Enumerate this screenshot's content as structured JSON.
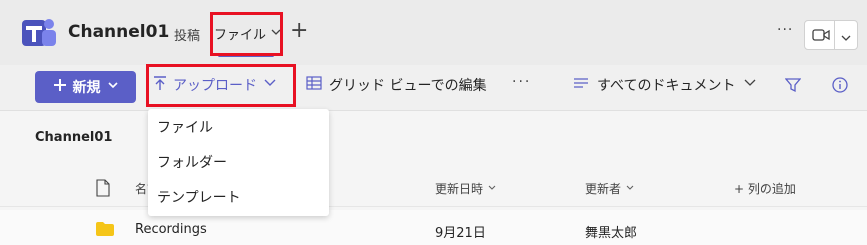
{
  "header": {
    "channel_title": "Channel01",
    "tabs": [
      {
        "label": "投稿"
      },
      {
        "label": "ファイル"
      }
    ],
    "add_tab_symbol": "+",
    "more_symbol": "···"
  },
  "toolbar": {
    "new_label": "新規",
    "upload_label": "アップロード",
    "grid_edit_label": "グリッド ビューでの編集",
    "more_symbol": "···",
    "all_docs_label": "すべてのドキュメント"
  },
  "breadcrumb": "Channel01",
  "upload_menu": {
    "items": [
      {
        "label": "ファイル"
      },
      {
        "label": "フォルダー"
      },
      {
        "label": "テンプレート"
      }
    ]
  },
  "list": {
    "columns": {
      "name": "名前",
      "modified": "更新日時",
      "modified_by": "更新者",
      "add_column": "+ 列の追加"
    },
    "rows": [
      {
        "name": "Recordings",
        "modified": "9月21日",
        "modified_by": "舞黒太郎"
      }
    ]
  },
  "colors": {
    "accent": "#5b5fc7",
    "highlight": "#e81123",
    "folder": "#f5c518"
  },
  "icons": [
    "teams-logo",
    "chevron-down-icon",
    "plus-icon",
    "video-icon",
    "upload-icon",
    "grid-icon",
    "list-icon",
    "filter-icon",
    "info-icon",
    "file-icon",
    "folder-icon"
  ]
}
